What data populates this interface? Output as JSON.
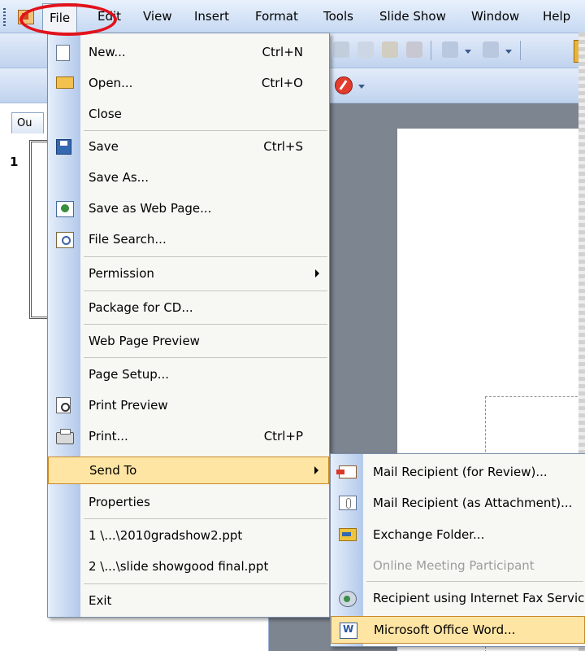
{
  "menubar": {
    "items": [
      "File",
      "Edit",
      "View",
      "Insert",
      "Format",
      "Tools",
      "Slide Show",
      "Window",
      "Help"
    ]
  },
  "left_panel": {
    "tab_label": "Ou",
    "slide_number": "1"
  },
  "file_menu": {
    "items": [
      {
        "label": "New...",
        "shortcut": "Ctrl+N",
        "icon": "new-document-icon"
      },
      {
        "label": "Open...",
        "shortcut": "Ctrl+O",
        "icon": "open-folder-icon"
      },
      {
        "label": "Close"
      },
      {
        "label": "Save",
        "shortcut": "Ctrl+S",
        "icon": "save-disk-icon"
      },
      {
        "label": "Save As..."
      },
      {
        "label": "Save as Web Page...",
        "icon": "web-page-icon"
      },
      {
        "label": "File Search...",
        "icon": "file-search-icon"
      },
      {
        "label": "Permission",
        "submenu": true
      },
      {
        "label": "Package for CD..."
      },
      {
        "label": "Web Page Preview"
      },
      {
        "label": "Page Setup..."
      },
      {
        "label": "Print Preview",
        "icon": "print-preview-icon"
      },
      {
        "label": "Print...",
        "shortcut": "Ctrl+P",
        "icon": "printer-icon"
      },
      {
        "label": "Send To",
        "submenu": true,
        "selected": true
      },
      {
        "label": "Properties"
      },
      {
        "label": "1 \\...\\2010gradshow2.ppt"
      },
      {
        "label": "2 \\...\\slide showgood final.ppt"
      },
      {
        "label": "Exit"
      }
    ]
  },
  "send_to_menu": {
    "items": [
      {
        "label": "Mail Recipient (for Review)...",
        "icon": "mail-review-icon"
      },
      {
        "label": "Mail Recipient (as Attachment)...",
        "icon": "mail-attachment-icon"
      },
      {
        "label": "Exchange Folder...",
        "icon": "exchange-folder-icon"
      },
      {
        "label": "Online Meeting Participant",
        "disabled": true
      },
      {
        "label": "Recipient using Internet Fax Service...",
        "icon": "internet-fax-icon"
      },
      {
        "label": "Microsoft Office Word...",
        "icon": "word-document-icon",
        "selected": true
      }
    ]
  },
  "colors": {
    "highlight_ring": "#e2121c",
    "selected_item": "#ffe5a3",
    "menu_background": "#f7f7f3"
  }
}
